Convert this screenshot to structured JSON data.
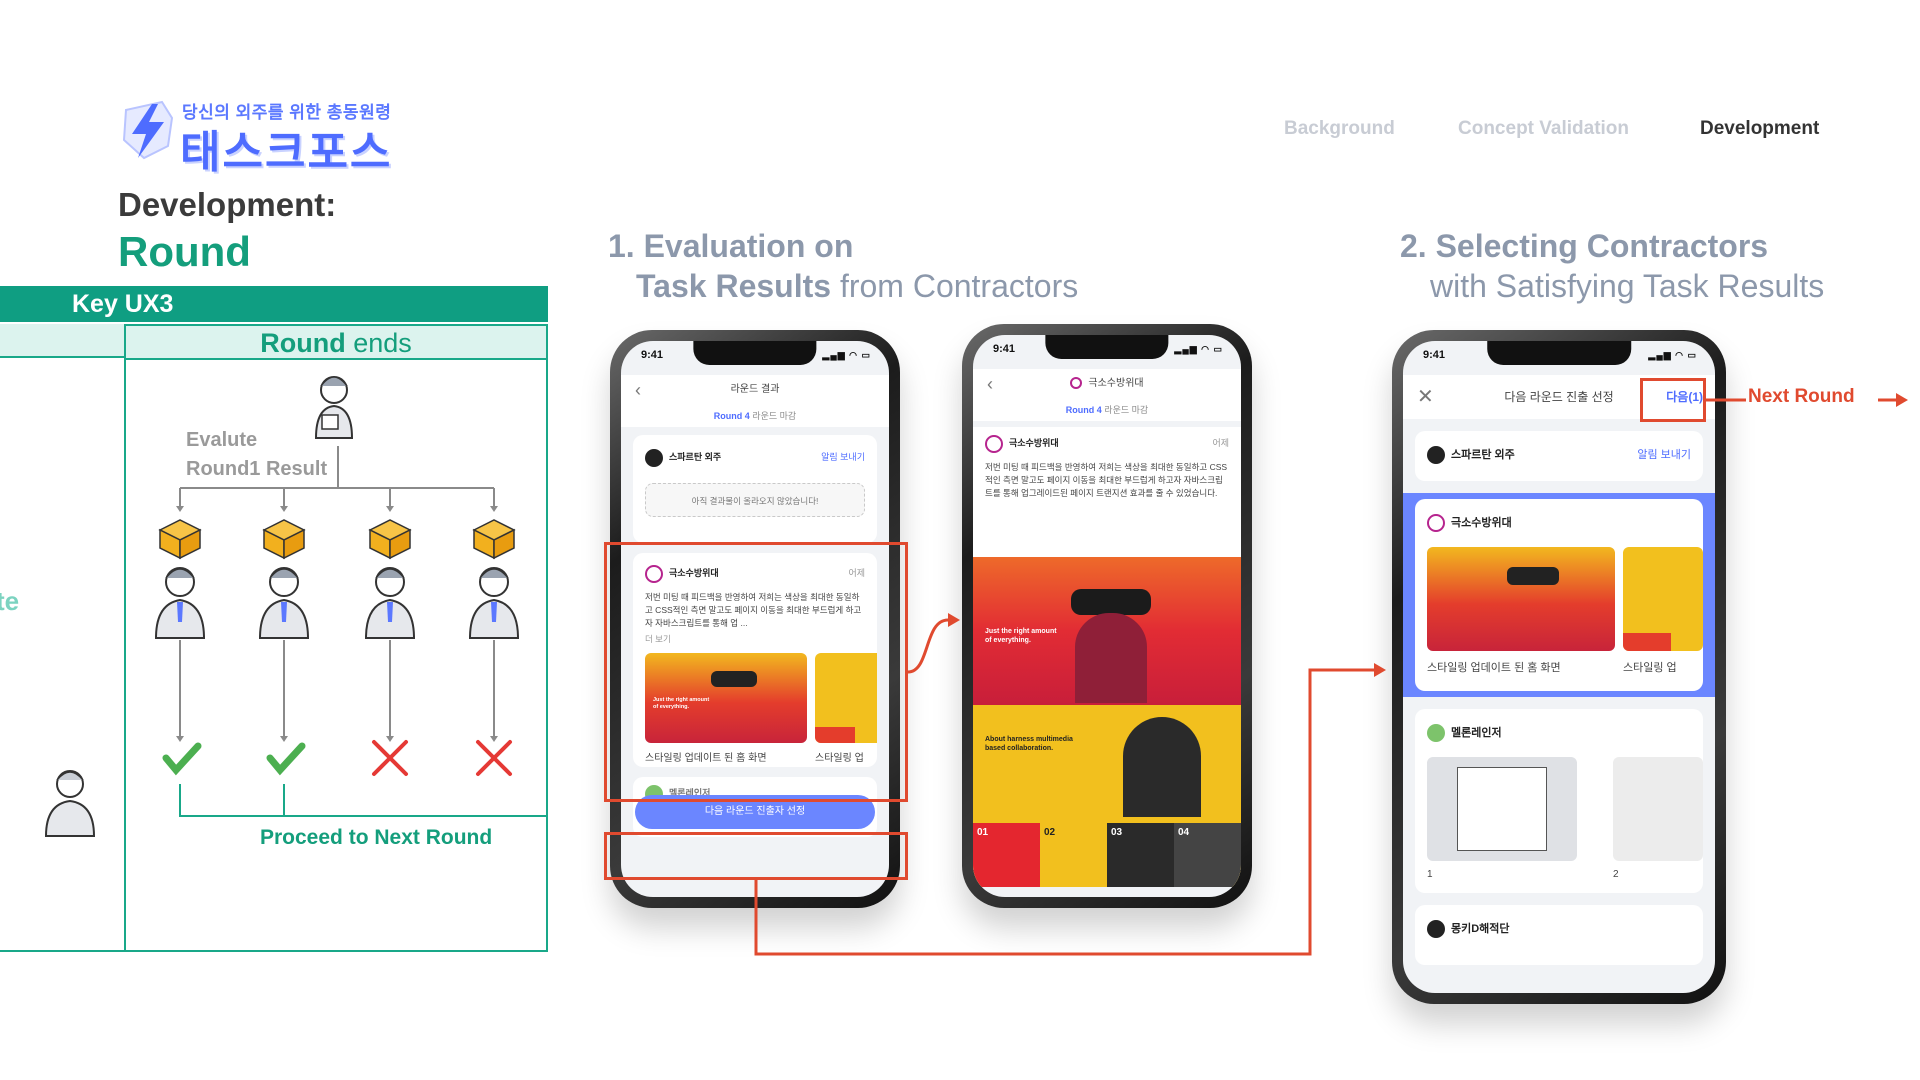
{
  "logo": {
    "tagline": "당신의 외주를 위한 총동원령",
    "name": "태스크포스",
    "icon": "lightning-shield-icon"
  },
  "nav": {
    "items": [
      "Background",
      "Concept Validation",
      "Development"
    ],
    "active": "Development"
  },
  "left": {
    "dev_label": "Development:",
    "dev_title": "Round",
    "key_bar": "Key UX3",
    "round_ends_bold": "Round",
    "round_ends_rest": " ends",
    "cut_text": "te",
    "eval_line1": "Evalute",
    "eval_line2": "Round1 Result",
    "outcomes": [
      "check",
      "check",
      "cross",
      "cross"
    ],
    "proceed": "Proceed to Next Round"
  },
  "section1": {
    "line1": "1. Evaluation on",
    "line2_bold": "Task Results",
    "line2_rest": " from Contractors"
  },
  "section2": {
    "line1": "2. Selecting Contractors",
    "line2": "with Satisfying Task Results"
  },
  "phone1": {
    "time": "9:41",
    "title": "라운드 결과",
    "round_bold": "Round 4",
    "round_rest": " 라운드 마감",
    "c1_name": "스파르탄 외주",
    "c1_link": "알림 보내기",
    "empty_msg": "아직 결과물이 올라오지 않았습니다!",
    "c2_name": "극소수방위대",
    "c2_time": "어제",
    "c2_body": "저번 미팅 때 피드백을 반영하여 저희는 색상을 최대한 동일하고 CSS적인 측면 말고도 페이지 이동을 최대한 부드럽게 하고자 자바스크립트를 통해 업 ...",
    "more": "더 보기",
    "thumb_text": "Just the right amount of everything.",
    "cap1": "스타일링 업데이트 된 홈 화면",
    "cap2": "스타일링 업",
    "next_partial": "멜론레인저",
    "cta": "다음 라운드 진출자 선정"
  },
  "phone2": {
    "time": "9:41",
    "title": "극소수방위대",
    "round_bold": "Round 4",
    "round_rest": " 라운드 마감",
    "name": "극소수방위대",
    "time_ago": "어제",
    "body": "저번 미팅 때 피드백을 반영하여 저희는 색상을 최대한 동일하고 CSS적인 측면 말고도 페이지 이동을 최대한 부드럽게 하고자 자바스크립트를 통해 업그레이드된 페이지 트랜지션 효과를 줄 수 있었습니다.",
    "hero_text": "Just the right amount of everything.",
    "yellow_text": "About harness multimedia based collaboration.",
    "tiles": [
      "01",
      "02",
      "03",
      "04"
    ]
  },
  "phone3": {
    "time": "9:41",
    "title": "다음 라운드 진출 선정",
    "next_btn": "다음(1)",
    "c1_name": "스파르탄 외주",
    "c1_link": "알림 보내기",
    "c2_name": "극소수방위대",
    "cap1": "스타일링 업데이트 된 홈 화면",
    "cap2": "스타일링 업",
    "c3_name": "멜론레인저",
    "n1": "1",
    "n2": "2",
    "c4_name": "몽키D해적단"
  },
  "annotations": {
    "next_round": "Next Round"
  },
  "colors": {
    "accent_green": "#149e7c",
    "brand_blue": "#4e6cff",
    "annotation_red": "#e04a2f"
  }
}
